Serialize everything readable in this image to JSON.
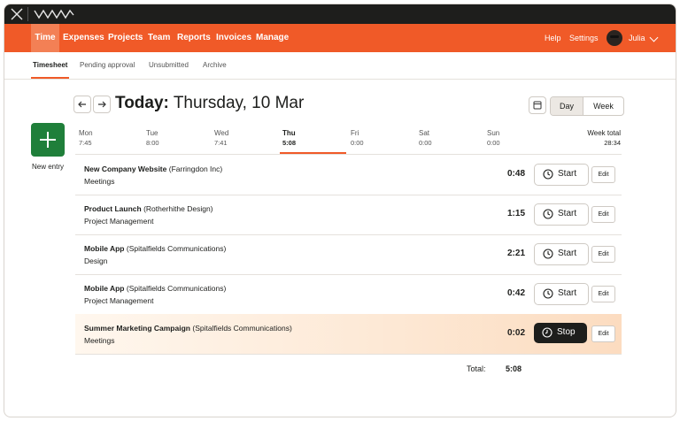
{
  "nav": {
    "items": [
      "Time",
      "Expenses",
      "Projects",
      "Team",
      "Reports",
      "Invoices",
      "Manage"
    ],
    "help": "Help",
    "settings": "Settings",
    "user": "Julia"
  },
  "subnav": {
    "tabs": [
      "Timesheet",
      "Pending approval",
      "Unsubmitted",
      "Archive"
    ]
  },
  "header": {
    "today": "Today:",
    "date": "Thursday, 10 Mar",
    "view_day": "Day",
    "view_week": "Week"
  },
  "new_entry": "New entry",
  "week": {
    "days": [
      {
        "name": "Mon",
        "value": "7:45"
      },
      {
        "name": "Tue",
        "value": "8:00"
      },
      {
        "name": "Wed",
        "value": "7:41"
      },
      {
        "name": "Thu",
        "value": "5:08"
      },
      {
        "name": "Fri",
        "value": "0:00"
      },
      {
        "name": "Sat",
        "value": "0:00"
      },
      {
        "name": "Sun",
        "value": "0:00"
      }
    ],
    "total_label": "Week total",
    "total_value": "28:34"
  },
  "entries": [
    {
      "project": "New Company Website",
      "client": "(Farringdon Inc)",
      "task": "Meetings",
      "duration": "0:48",
      "action": "Start",
      "edit": "Edit"
    },
    {
      "project": "Product Launch",
      "client": "(Rotherhithe Design)",
      "task": "Project Management",
      "duration": "1:15",
      "action": "Start",
      "edit": "Edit"
    },
    {
      "project": "Mobile App",
      "client": "(Spitalfields Communications)",
      "task": "Design",
      "duration": "2:21",
      "action": "Start",
      "edit": "Edit"
    },
    {
      "project": "Mobile App",
      "client": "(Spitalfields Communications)",
      "task": "Project Management",
      "duration": "0:42",
      "action": "Start",
      "edit": "Edit"
    },
    {
      "project": "Summer Marketing Campaign",
      "client": "(Spitalfields Communications)",
      "task": "Meetings",
      "duration": "0:02",
      "action": "Stop",
      "edit": "Edit"
    }
  ],
  "total": {
    "label": "Total:",
    "value": "5:08"
  },
  "colors": {
    "brand": "#f05a28",
    "new_entry": "#1f7f3a",
    "dark": "#1d1e1c"
  }
}
